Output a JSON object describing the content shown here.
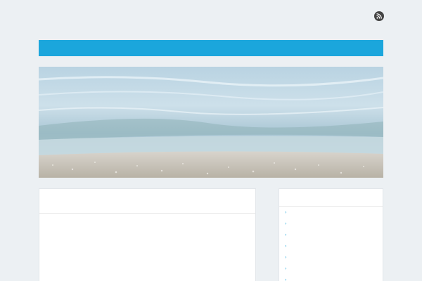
{
  "header": {
    "site_title": "",
    "site_description": "",
    "rss_icon": "rss-icon"
  },
  "nav": {
    "items": [
      {
        "label": ""
      }
    ]
  },
  "hero": {
    "image": "beach-shoreline-photo"
  },
  "post": {
    "title": "",
    "paragraphs": [
      [
        "",
        "",
        ""
      ],
      [
        "",
        "",
        "",
        ""
      ]
    ]
  },
  "sidebar": {
    "title": "",
    "links": [
      {
        "label": ""
      },
      {
        "label": ""
      },
      {
        "label": ""
      },
      {
        "label": ""
      },
      {
        "label": ""
      },
      {
        "label": ""
      },
      {
        "label": ""
      }
    ]
  },
  "colors": {
    "accent": "#1ba6dc",
    "background": "#ecf0f3",
    "rss": "#444444"
  }
}
